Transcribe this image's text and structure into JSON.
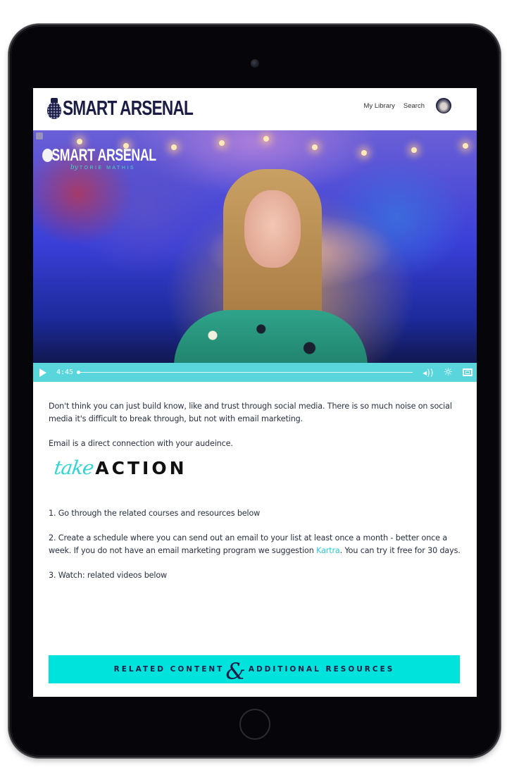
{
  "header": {
    "logo_text": "SMART ARSENAL",
    "nav": [
      {
        "label": "My Library"
      },
      {
        "label": "Search"
      }
    ],
    "avatar_alt": "user-avatar"
  },
  "video": {
    "watermark_title": "SMART ARSENAL",
    "watermark_by": "by",
    "watermark_author": "TORIE MATHIS",
    "time": "4:45",
    "progress": 0.0,
    "icons": {
      "play": "play-icon",
      "volume": "volume-icon",
      "settings": "gear-icon",
      "fullscreen": "fullscreen-icon"
    },
    "volume_glyph": "◂))",
    "settings_glyph": "☼"
  },
  "article": {
    "paragraph_1": "Don't think you can just build know, like and trust through social media. There is so much noise on social media it's difficult to break through, but not with email marketing.",
    "paragraph_2": "Email is a direct connection with your audeince.",
    "take_action": {
      "script": "take",
      "bold": "ACTION"
    },
    "step_1": "1. Go through the related courses and resources below",
    "step_2_before": "2. Create a schedule where you can send out an email to your list at least once a month - better once a week. If you do not have an email marketing program we suggestion ",
    "step_2_link": "Kartra",
    "step_2_after": ". You can try it free for 30 days.",
    "step_3": "3. Watch: related videos below"
  },
  "banner": {
    "left": "RELATED CONTENT",
    "amp": "&",
    "right": "ADDITIONAL RESOURCES"
  },
  "colors": {
    "brand_navy": "#1b1d45",
    "accent_teal": "#00e3dd",
    "player_bar": "#58d6dc",
    "link": "#2ec8d0"
  }
}
